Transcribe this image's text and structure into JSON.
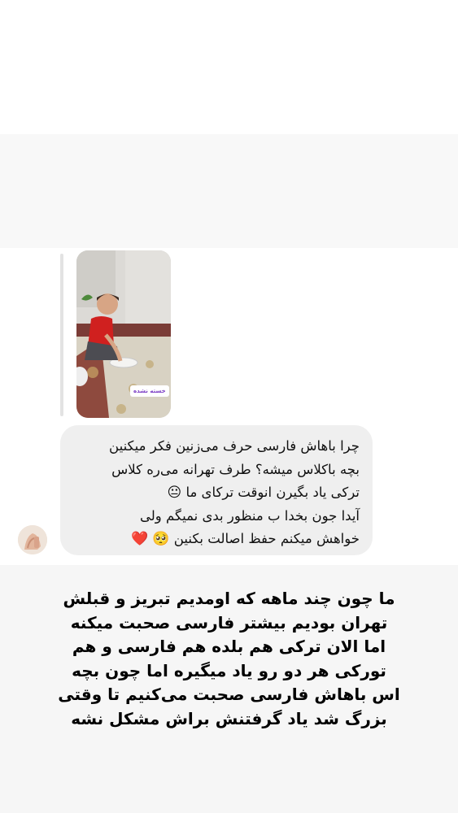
{
  "story": {
    "badge_text": "خسته نشده"
  },
  "message": {
    "lines": [
      "چرا باهاش فارسی حرف می‌زنین فکر میکنین",
      "بچه باکلاس میشه؟ طرف تهرانه می‌ره کلاس",
      "ترکی یاد بگیرن انوقت ترکای ما",
      "آیدا جون بخدا ب منظور بدی نمیگم ولی",
      "خواهش میکنم حفظ اصالت بکنین"
    ],
    "emoji_1": "😐",
    "emoji_2": "🥺",
    "emoji_3": "❤️"
  },
  "caption": {
    "lines": [
      "ما چون چند ماهه که اومدیم تبریز و قبلش",
      "تهران بودیم بیشتر فارسی صحبت میکنه",
      "اما الان ترکی هم بلده هم فارسی و هم",
      "تورکی هر دو رو یاد میگیره اما چون بچه",
      "اس باهاش فارسی صحبت می‌کنیم تا وقتی",
      "بزرگ شد یاد گرفتنش براش مشکل نشه"
    ]
  },
  "colors": {
    "bubble": "#efefef",
    "badge_text": "#7a3bc4"
  }
}
